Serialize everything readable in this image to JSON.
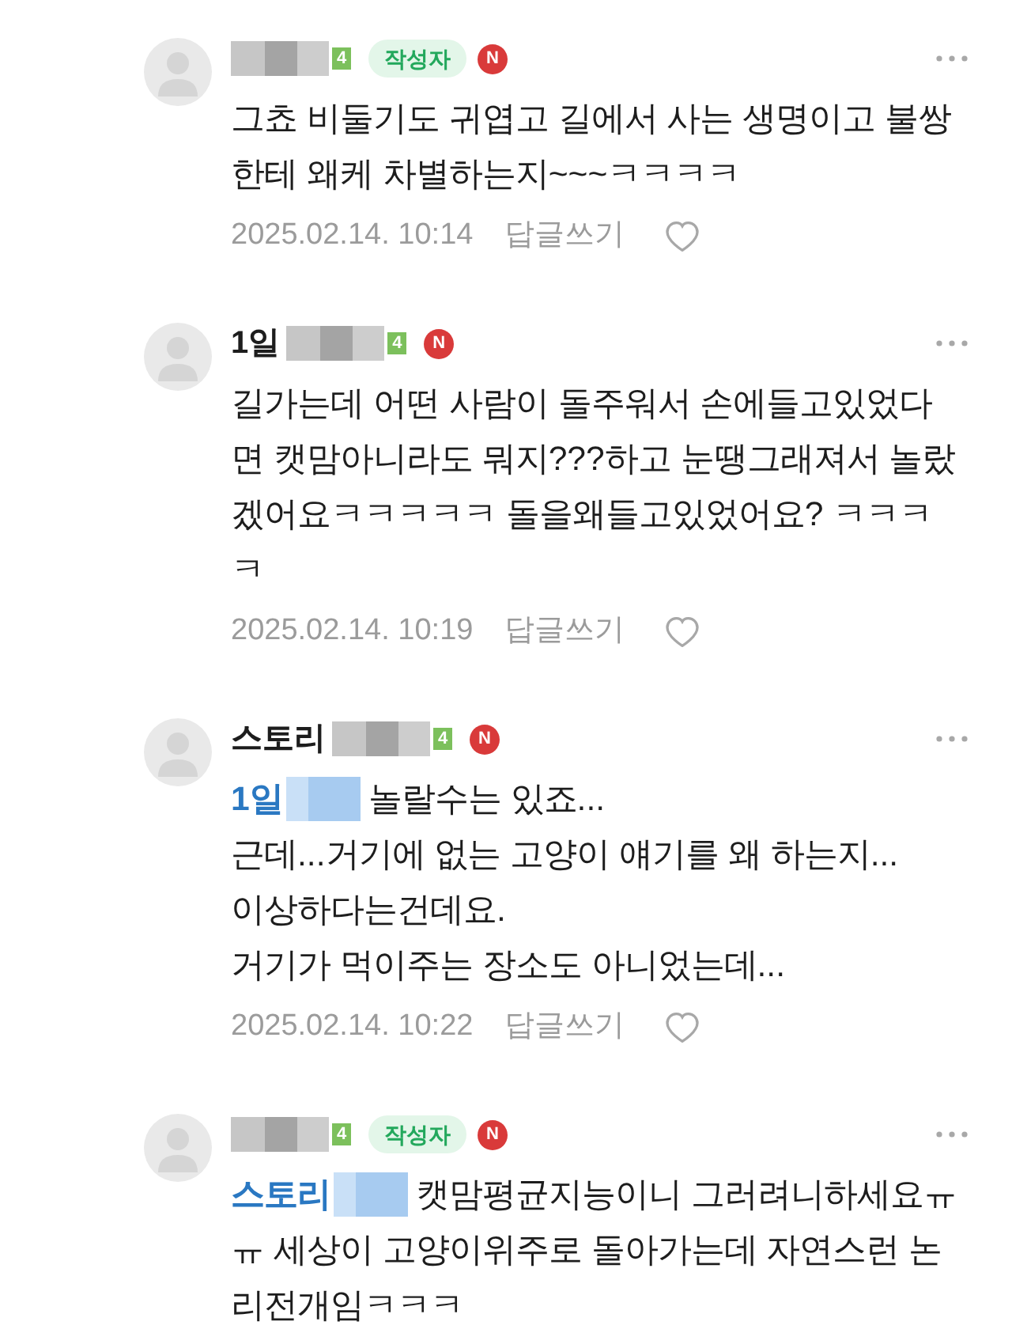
{
  "comments": [
    {
      "author": {
        "name_redacted": true,
        "level": "4",
        "writer_badge": "작성자",
        "new_badge": "N"
      },
      "text": "그쵸 비둘기도 귀엽고 길에서 사는 생명이고 불쌍한테 왜케 차별하는지~~~ㅋㅋㅋㅋ",
      "date": "2025.02.14. 10:14",
      "reply": "답글쓰기",
      "liked": false
    },
    {
      "author": {
        "name": "1일",
        "name_redacted": true,
        "level": "4",
        "new_badge": "N"
      },
      "text": "길가는데 어떤 사람이 돌주워서 손에들고있었다면 캣맘아니라도 뭐지???하고 눈땡그래져서 놀랐겠어요ㅋㅋㅋㅋㅋ 돌을왜들고있었어요? ㅋㅋㅋㅋ",
      "date": "2025.02.14. 10:19",
      "reply": "답글쓰기",
      "liked": false
    },
    {
      "author": {
        "name": "스토리",
        "name_redacted": true,
        "level": "4",
        "new_badge": "N"
      },
      "mention": {
        "name": "1일",
        "redacted": true
      },
      "text": "놀랄수는 있죠...\n근데...거기에 없는 고양이 얘기를 왜 하는지...\n이상하다는건데요.\n거기가 먹이주는 장소도 아니었는데...",
      "date": "2025.02.14. 10:22",
      "reply": "답글쓰기",
      "liked": false
    },
    {
      "author": {
        "name_redacted": true,
        "level": "4",
        "writer_badge": "작성자",
        "new_badge": "N"
      },
      "mention": {
        "name": "스토리",
        "redacted": true
      },
      "text": "캣맘평균지능이니 그러려니하세요ㅠㅠ 세상이 고양이위주로 돌아가는데 자연스런 논리전개임ㅋㅋㅋ"
    }
  ]
}
